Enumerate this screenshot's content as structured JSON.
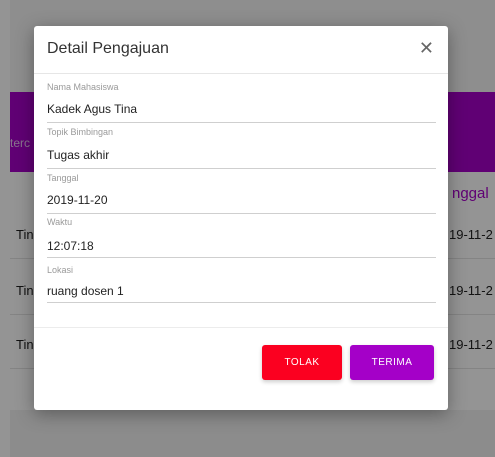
{
  "background": {
    "banner_text": "terc",
    "column_header": "nggal",
    "rows": [
      {
        "left": "Tin",
        "right": "19-11-2"
      },
      {
        "left": "Tin",
        "right": "19-11-2"
      },
      {
        "left": "Tin",
        "right": "19-11-2"
      }
    ]
  },
  "modal": {
    "title": "Detail Pengajuan",
    "close_icon": "close-icon",
    "fields": [
      {
        "label": "Nama Mahasiswa",
        "value": "Kadek Agus Tina"
      },
      {
        "label": "Topik Bimbingan",
        "value": "Tugas akhir"
      },
      {
        "label": "Tanggal",
        "value": "2019-11-20"
      },
      {
        "label": "Waktu",
        "value": "12:07:18"
      },
      {
        "label": "Lokasi",
        "value": "ruang dosen 1"
      }
    ],
    "buttons": {
      "reject_label": "TOLAK",
      "accept_label": "TERIMA"
    }
  },
  "colors": {
    "accent_purple": "#a600c8",
    "reject_red": "#fb0020",
    "accept_purple": "#a400c8"
  }
}
